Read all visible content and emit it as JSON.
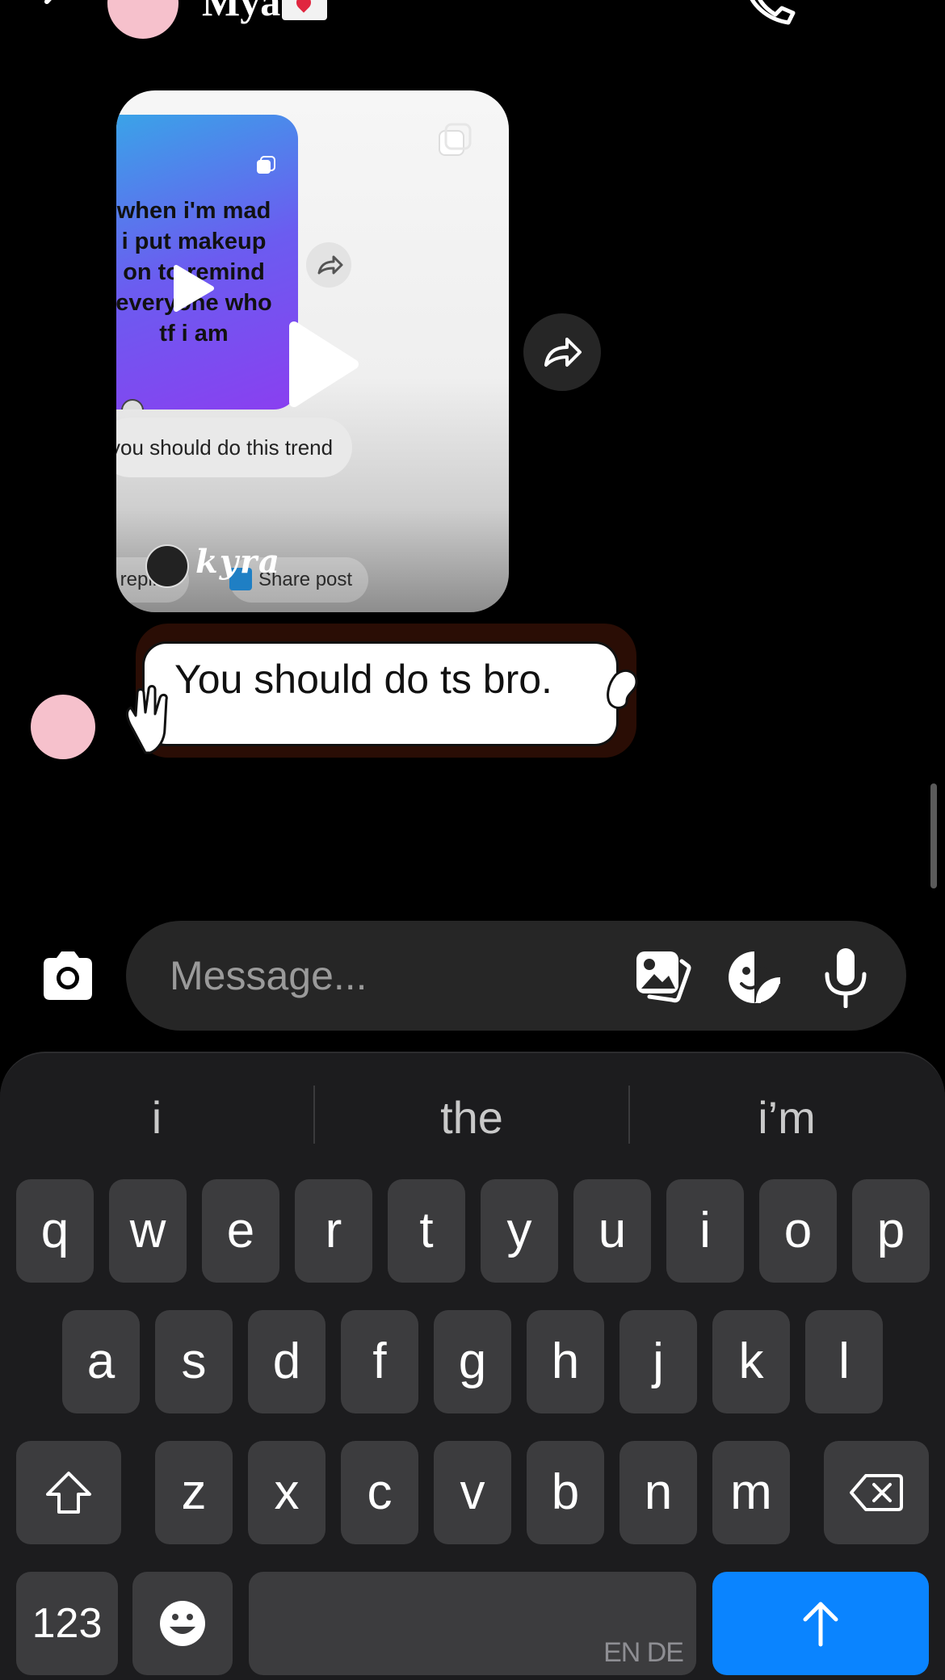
{
  "header": {
    "contact_name": "Mya",
    "icons": [
      "back-icon",
      "phone-icon",
      "more-icon",
      "envelope-heart-emoji"
    ]
  },
  "post": {
    "inner_text": "when i'm mad\ni put makeup\non to remind\neveryone who\ntf i am",
    "inner_caption": "you should do this trend",
    "inner_left_pill": "k replies",
    "inner_right_pill": "Share post",
    "author": "kyra"
  },
  "message": {
    "text": "You should do ts bro."
  },
  "composer": {
    "placeholder": "Message..."
  },
  "keyboard": {
    "suggestions": [
      "i",
      "the",
      "i’m"
    ],
    "row1": [
      "q",
      "w",
      "e",
      "r",
      "t",
      "y",
      "u",
      "i",
      "o",
      "p"
    ],
    "row2": [
      "a",
      "s",
      "d",
      "f",
      "g",
      "h",
      "j",
      "k",
      "l"
    ],
    "row3": [
      "z",
      "x",
      "c",
      "v",
      "b",
      "n",
      "m"
    ],
    "numbers_label": "123",
    "space_lang": "EN DE"
  },
  "colors": {
    "background": "#000000",
    "composer": "#262626",
    "keyboard": "#1c1c1e",
    "key": "#3c3c3e",
    "send": "#0a84ff",
    "avatar": "#f6c1cc"
  }
}
